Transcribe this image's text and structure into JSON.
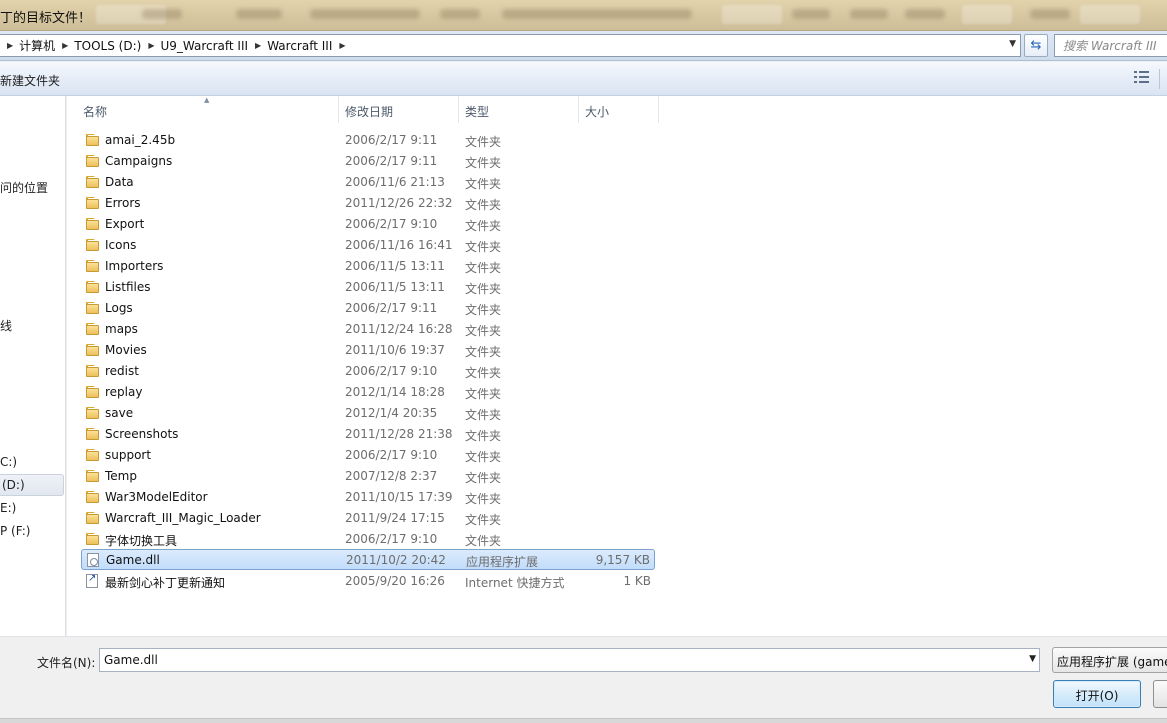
{
  "window": {
    "title": "丁的目标文件！"
  },
  "address": {
    "crumbs": [
      "计算机",
      "TOOLS (D:)",
      "U9_Warcraft III",
      "Warcraft III"
    ],
    "search_placeholder": "搜索 Warcraft III"
  },
  "toolbar": {
    "new_folder": "新建文件夹"
  },
  "nav": {
    "items": [
      "问的位置",
      "线",
      "C:)",
      "(D:)",
      "E:)",
      "P (F:)"
    ],
    "selected": "(D:)"
  },
  "columns": {
    "name": "名称",
    "date": "修改日期",
    "type": "类型",
    "size": "大小"
  },
  "files": [
    {
      "name": "amai_2.45b",
      "date": "2006/2/17 9:11",
      "type": "文件夹",
      "size": "",
      "icon": "folder-icon"
    },
    {
      "name": "Campaigns",
      "date": "2006/2/17 9:11",
      "type": "文件夹",
      "size": "",
      "icon": "folder-icon"
    },
    {
      "name": "Data",
      "date": "2006/11/6 21:13",
      "type": "文件夹",
      "size": "",
      "icon": "folder-icon"
    },
    {
      "name": "Errors",
      "date": "2011/12/26 22:32",
      "type": "文件夹",
      "size": "",
      "icon": "folder-icon"
    },
    {
      "name": "Export",
      "date": "2006/2/17 9:10",
      "type": "文件夹",
      "size": "",
      "icon": "folder-icon"
    },
    {
      "name": "Icons",
      "date": "2006/11/16 16:41",
      "type": "文件夹",
      "size": "",
      "icon": "folder-icon"
    },
    {
      "name": "Importers",
      "date": "2006/11/5 13:11",
      "type": "文件夹",
      "size": "",
      "icon": "folder-icon"
    },
    {
      "name": "Listfiles",
      "date": "2006/11/5 13:11",
      "type": "文件夹",
      "size": "",
      "icon": "folder-icon"
    },
    {
      "name": "Logs",
      "date": "2006/2/17 9:11",
      "type": "文件夹",
      "size": "",
      "icon": "folder-icon"
    },
    {
      "name": "maps",
      "date": "2011/12/24 16:28",
      "type": "文件夹",
      "size": "",
      "icon": "folder-icon"
    },
    {
      "name": "Movies",
      "date": "2011/10/6 19:37",
      "type": "文件夹",
      "size": "",
      "icon": "folder-icon"
    },
    {
      "name": "redist",
      "date": "2006/2/17 9:10",
      "type": "文件夹",
      "size": "",
      "icon": "folder-icon"
    },
    {
      "name": "replay",
      "date": "2012/1/14 18:28",
      "type": "文件夹",
      "size": "",
      "icon": "folder-icon"
    },
    {
      "name": "save",
      "date": "2012/1/4 20:35",
      "type": "文件夹",
      "size": "",
      "icon": "folder-icon"
    },
    {
      "name": "Screenshots",
      "date": "2011/12/28 21:38",
      "type": "文件夹",
      "size": "",
      "icon": "folder-icon"
    },
    {
      "name": "support",
      "date": "2006/2/17 9:10",
      "type": "文件夹",
      "size": "",
      "icon": "folder-icon"
    },
    {
      "name": "Temp",
      "date": "2007/12/8 2:37",
      "type": "文件夹",
      "size": "",
      "icon": "folder-icon"
    },
    {
      "name": "War3ModelEditor",
      "date": "2011/10/15 17:39",
      "type": "文件夹",
      "size": "",
      "icon": "folder-icon"
    },
    {
      "name": "Warcraft_III_Magic_Loader",
      "date": "2011/9/24 17:15",
      "type": "文件夹",
      "size": "",
      "icon": "folder-icon"
    },
    {
      "name": "字体切换工具",
      "date": "2006/2/17 9:10",
      "type": "文件夹",
      "size": "",
      "icon": "folder-icon"
    },
    {
      "name": "Game.dll",
      "date": "2011/10/2 20:42",
      "type": "应用程序扩展",
      "size": "9,157 KB",
      "icon": "dll-file-icon",
      "selected": true
    },
    {
      "name": "最新剑心补丁更新通知",
      "date": "2005/9/20 16:26",
      "type": "Internet 快捷方式",
      "size": "1 KB",
      "icon": "internet-shortcut-icon"
    }
  ],
  "bottom": {
    "filename_label": "文件名(N):",
    "filename_value": "Game.dll",
    "filter_value": "应用程序扩展 (game",
    "open_label": "打开(O)"
  }
}
